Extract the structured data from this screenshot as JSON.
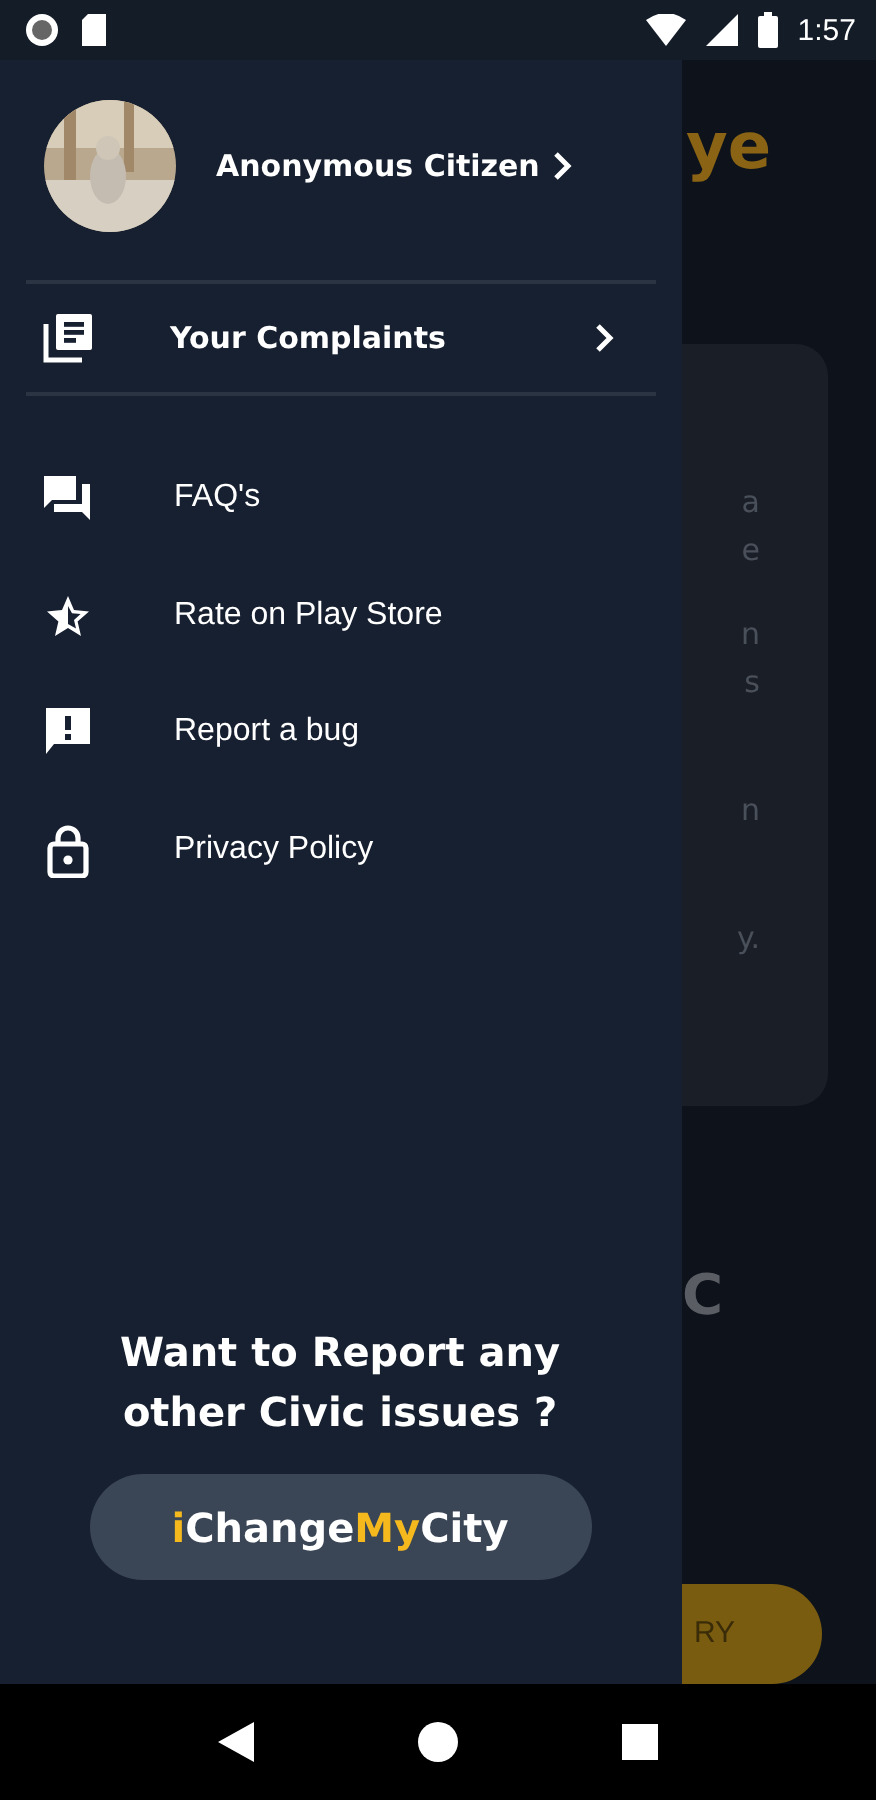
{
  "status_bar": {
    "time": "1:57"
  },
  "drawer": {
    "profile": {
      "name": "Anonymous Citizen"
    },
    "complaints": {
      "label": "Your Complaints"
    },
    "menu": [
      {
        "label": "FAQ's",
        "kind": "chat"
      },
      {
        "label": "Rate on Play Store",
        "kind": "star"
      },
      {
        "label": "Report a bug",
        "kind": "feedback"
      },
      {
        "label": "Privacy Policy",
        "kind": "lock"
      }
    ],
    "footer": {
      "prompt": "Want to Report any other Civic issues ?",
      "brand": [
        {
          "text": "i",
          "color": "#f5b91e"
        },
        {
          "text": "Change",
          "color": "#ffffff"
        },
        {
          "text": "My",
          "color": "#f5b91e"
        },
        {
          "text": "City",
          "color": "#ffffff"
        }
      ]
    }
  },
  "background": {
    "title": "ye",
    "card_lines": [
      "a",
      "e",
      "n",
      "s",
      "n",
      "y."
    ],
    "heading": "C",
    "button": "RY"
  }
}
